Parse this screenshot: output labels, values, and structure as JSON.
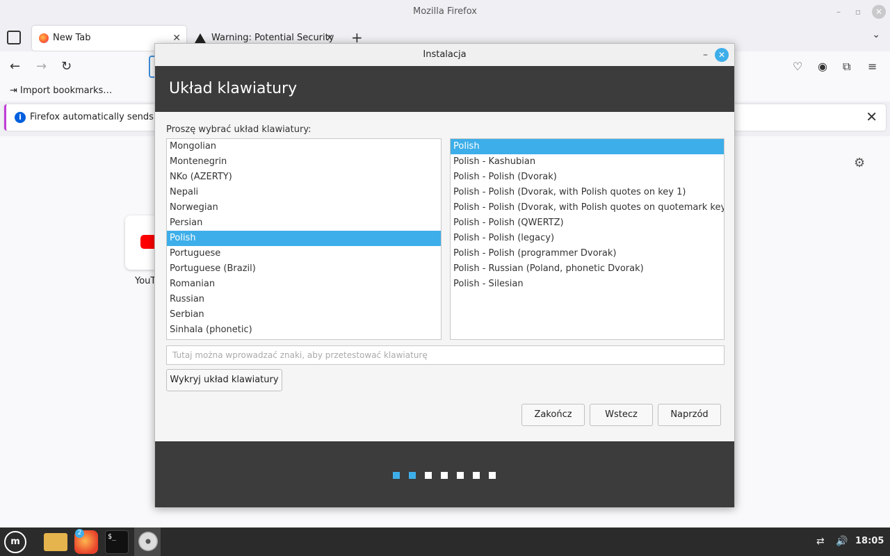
{
  "firefox": {
    "window_title": "Mozilla Firefox",
    "tabs": [
      {
        "label": "New Tab"
      },
      {
        "label": "Warning: Potential Security"
      }
    ],
    "bookmarks": {
      "import_label": "Import bookmarks…"
    },
    "infobar": {
      "text": "Firefox automatically sends so"
    },
    "shortcut": {
      "label": "YouT"
    }
  },
  "installer": {
    "window_title": "Instalacja",
    "header": "Układ klawiatury",
    "prompt": "Proszę wybrać układ klawiatury:",
    "layouts": [
      {
        "label": "Mongolian",
        "selected": false
      },
      {
        "label": "Montenegrin",
        "selected": false
      },
      {
        "label": "NKo (AZERTY)",
        "selected": false
      },
      {
        "label": "Nepali",
        "selected": false
      },
      {
        "label": "Norwegian",
        "selected": false
      },
      {
        "label": "Persian",
        "selected": false
      },
      {
        "label": "Polish",
        "selected": true
      },
      {
        "label": "Portuguese",
        "selected": false
      },
      {
        "label": "Portuguese (Brazil)",
        "selected": false
      },
      {
        "label": "Romanian",
        "selected": false
      },
      {
        "label": "Russian",
        "selected": false
      },
      {
        "label": "Serbian",
        "selected": false
      },
      {
        "label": "Sinhala (phonetic)",
        "selected": false
      }
    ],
    "variants": [
      {
        "label": "Polish",
        "selected": true
      },
      {
        "label": "Polish - Kashubian",
        "selected": false
      },
      {
        "label": "Polish - Polish (Dvorak)",
        "selected": false
      },
      {
        "label": "Polish - Polish (Dvorak, with Polish quotes on key 1)",
        "selected": false
      },
      {
        "label": "Polish - Polish (Dvorak, with Polish quotes on quotemark key)",
        "selected": false
      },
      {
        "label": "Polish - Polish (QWERTZ)",
        "selected": false
      },
      {
        "label": "Polish - Polish (legacy)",
        "selected": false
      },
      {
        "label": "Polish - Polish (programmer Dvorak)",
        "selected": false
      },
      {
        "label": "Polish - Russian (Poland, phonetic Dvorak)",
        "selected": false
      },
      {
        "label": "Polish - Silesian",
        "selected": false
      }
    ],
    "test_input": {
      "placeholder": "Tutaj można wprowadzać znaki, aby przetestować klawiaturę",
      "value": ""
    },
    "detect_button": "Wykryj układ klawiatury",
    "quit_button": "Zakończ",
    "back_button": "Wstecz",
    "next_button": "Naprzód",
    "progress": {
      "total_steps": 7,
      "completed_steps": 2
    }
  },
  "taskbar": {
    "firefox_badge": "2",
    "terminal_glyph": "$_",
    "clock": "18:05"
  },
  "colors": {
    "accent": "#3daee9",
    "header_bg": "#3c3c3c",
    "infobar_accent": "#c33bd8"
  }
}
